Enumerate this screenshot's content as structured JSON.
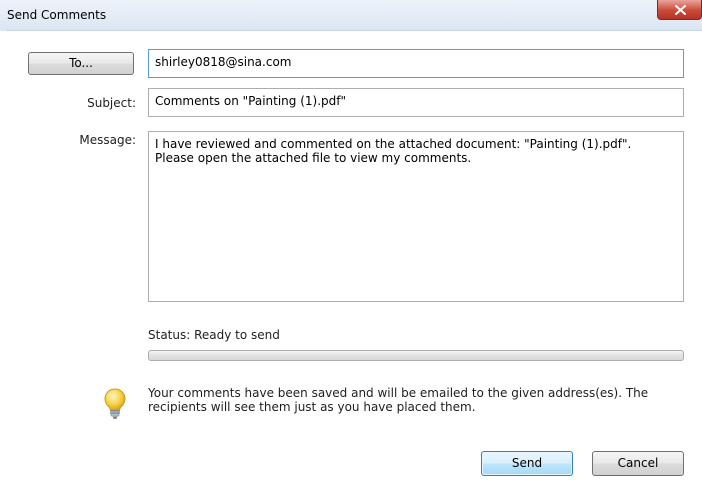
{
  "window": {
    "title": "Send Comments",
    "close_icon": "close-x-icon"
  },
  "form": {
    "to_button_label": "To...",
    "to_value": "shirley0818@sina.com",
    "subject_label": "Subject:",
    "subject_value": "Comments on \"Painting (1).pdf\"",
    "message_label": "Message:",
    "message_value": "I have reviewed and commented on the attached document: \"Painting (1).pdf\".\nPlease open the attached file to view my comments."
  },
  "status": {
    "text": "Status: Ready to send",
    "progress_percent": 0
  },
  "info": {
    "icon": "lightbulb-icon",
    "text": "Your comments have been saved and will be emailed to the given address(es). The recipients will see them just as you have placed them."
  },
  "buttons": {
    "send_label": "Send",
    "cancel_label": "Cancel"
  },
  "colors": {
    "title_bar": "#dbe6f3",
    "default_button": "#bee6fd",
    "close_button": "#c94b3a"
  }
}
